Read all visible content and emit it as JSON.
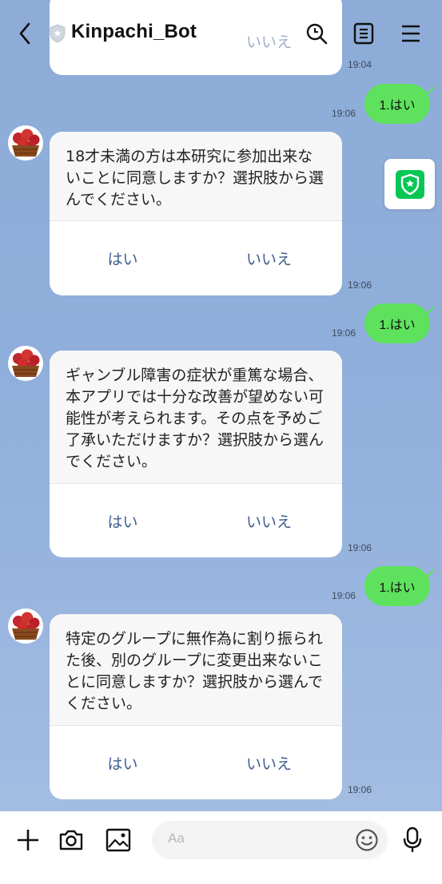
{
  "header": {
    "title": "Kinpachi_Bot",
    "back_icon": "chevron-left-icon",
    "search_icon": "search-icon",
    "notes_icon": "notes-icon",
    "menu_icon": "menu-icon"
  },
  "messages": [
    {
      "type": "bot",
      "question": "",
      "yes": "",
      "no": "いいえ",
      "time": "19:04"
    },
    {
      "type": "user",
      "text": "1.はい",
      "time": "19:06"
    },
    {
      "type": "bot",
      "question": "18才未満の方は本研究に参加出来ないことに同意しますか？選択肢から選んでください。",
      "yes": "はい",
      "no": "いいえ",
      "time": "19:06"
    },
    {
      "type": "user",
      "text": "1.はい",
      "time": "19:06"
    },
    {
      "type": "bot",
      "question": "ギャンブル障害の症状が重篤な場合、本アプリでは十分な改善が望めない可能性が考えられます。その点を予めご了承いただけますか？選択肢から選んでください。",
      "yes": "はい",
      "no": "いいえ",
      "time": "19:06"
    },
    {
      "type": "user",
      "text": "1.はい",
      "time": "19:06"
    },
    {
      "type": "bot",
      "question": "特定のグループに無作為に割り振られた後、別のグループに変更出来ないことに同意しますか？選択肢から選んでください。",
      "yes": "はい",
      "no": "いいえ",
      "time": "19:06"
    }
  ],
  "composer": {
    "placeholder": "Aa"
  },
  "colors": {
    "background": "#8eacd7",
    "user_bubble": "#5ee25d",
    "option_text": "#3d5d8f",
    "fab_green": "#06c755"
  }
}
